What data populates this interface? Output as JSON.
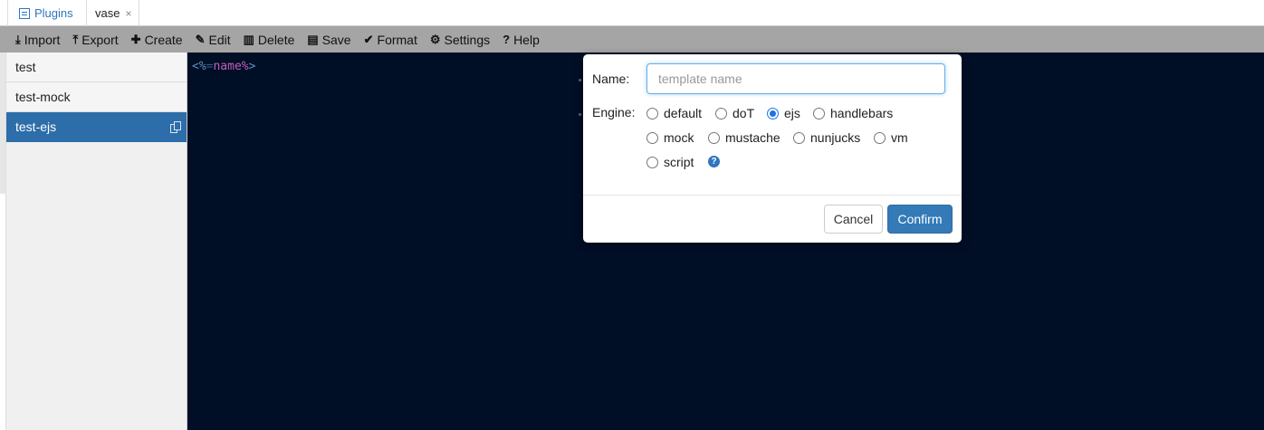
{
  "tabs": [
    {
      "label": "Plugins",
      "icon": "list-icon",
      "color": "#2f75c0"
    },
    {
      "label": "vase",
      "close": "×"
    }
  ],
  "toolbar": {
    "import": "Import",
    "export": "Export",
    "create": "Create",
    "edit": "Edit",
    "delete": "Delete",
    "save": "Save",
    "format": "Format",
    "settings": "Settings",
    "help": "Help"
  },
  "sidebar": {
    "items": [
      {
        "label": "test"
      },
      {
        "label": "test-mock"
      },
      {
        "label": "test-ejs",
        "active": true,
        "icon": "copy-icon"
      }
    ]
  },
  "editor": {
    "code_open": "<%",
    "code_sep": "=",
    "code_body": "name%",
    "code_close": ">"
  },
  "dialog": {
    "name_label": "Name:",
    "name_value": "",
    "name_placeholder": "template name",
    "engine_label": "Engine:",
    "engines": [
      {
        "label": "default",
        "checked": false
      },
      {
        "label": "doT",
        "checked": false
      },
      {
        "label": "ejs",
        "checked": true
      },
      {
        "label": "handlebars",
        "checked": false
      },
      {
        "label": "mock",
        "checked": false
      },
      {
        "label": "mustache",
        "checked": false
      },
      {
        "label": "nunjucks",
        "checked": false
      },
      {
        "label": "vm",
        "checked": false
      },
      {
        "label": "script",
        "checked": false
      }
    ],
    "help_icon": "question-circle-icon",
    "cancel": "Cancel",
    "confirm": "Confirm"
  },
  "colors": {
    "accent": "#337ab7",
    "editor_bg": "#000e26",
    "sidebar_active": "#2d6da9"
  }
}
